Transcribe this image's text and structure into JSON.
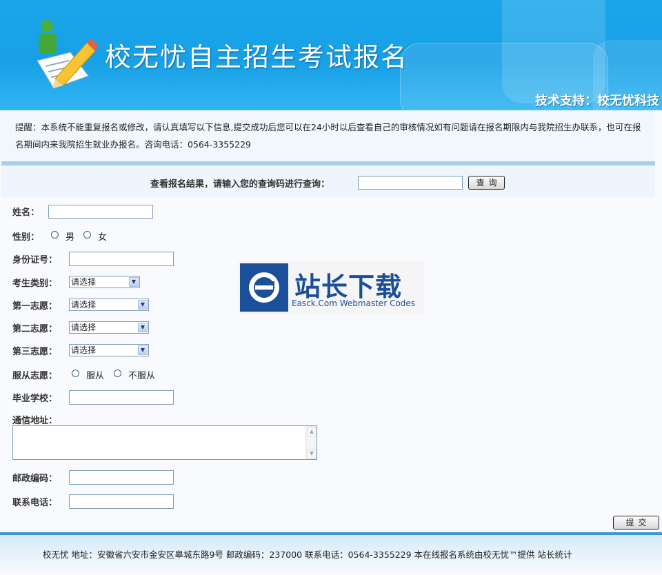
{
  "header": {
    "title": "校无忧自主招生考试报名",
    "tech_support": "技术支持：校无忧科技"
  },
  "notice": {
    "text": "提醒：本系统不能重复报名或修改，请认真填写以下信息,提交成功后您可以在24小时以后查看自己的审核情况如有问题请在报名期限内与我院招生办联系，也可在报名期间内来我院招生就业办报名。咨询电话：0564-3355229"
  },
  "query": {
    "label": "查看报名结果，请输入您的查询码进行查询：",
    "button": "查询"
  },
  "form": {
    "name_label": "姓名：",
    "gender_label": "性别：",
    "gender_male": "男",
    "gender_female": "女",
    "id_label": "身份证号：",
    "category_label": "考生类别：",
    "choice1_label": "第一志愿：",
    "choice2_label": "第二志愿：",
    "choice3_label": "第三志愿：",
    "select_placeholder": "请选择",
    "obey_label": "服从志愿：",
    "obey_yes": "服从",
    "obey_no": "不服从",
    "school_label": "毕业学校：",
    "address_label": "通信地址：",
    "postcode_label": "邮政编码：",
    "phone_label": "联系电话：",
    "submit": "提交"
  },
  "watermark": {
    "title": "站长下载",
    "subtitle": "Easck.Com Webmaster Codes"
  },
  "footer": {
    "text": "校无忧  地址：安徽省六安市金安区皋城东路9号  邮政编码：237000  联系电话：0564-3355229  本在线报名系统由校无忧™提供  站长统计"
  },
  "colors": {
    "header_blue": "#1aa6ea",
    "footer_bar": "#3c95d5",
    "watermark_blue": "#1c4f99"
  }
}
